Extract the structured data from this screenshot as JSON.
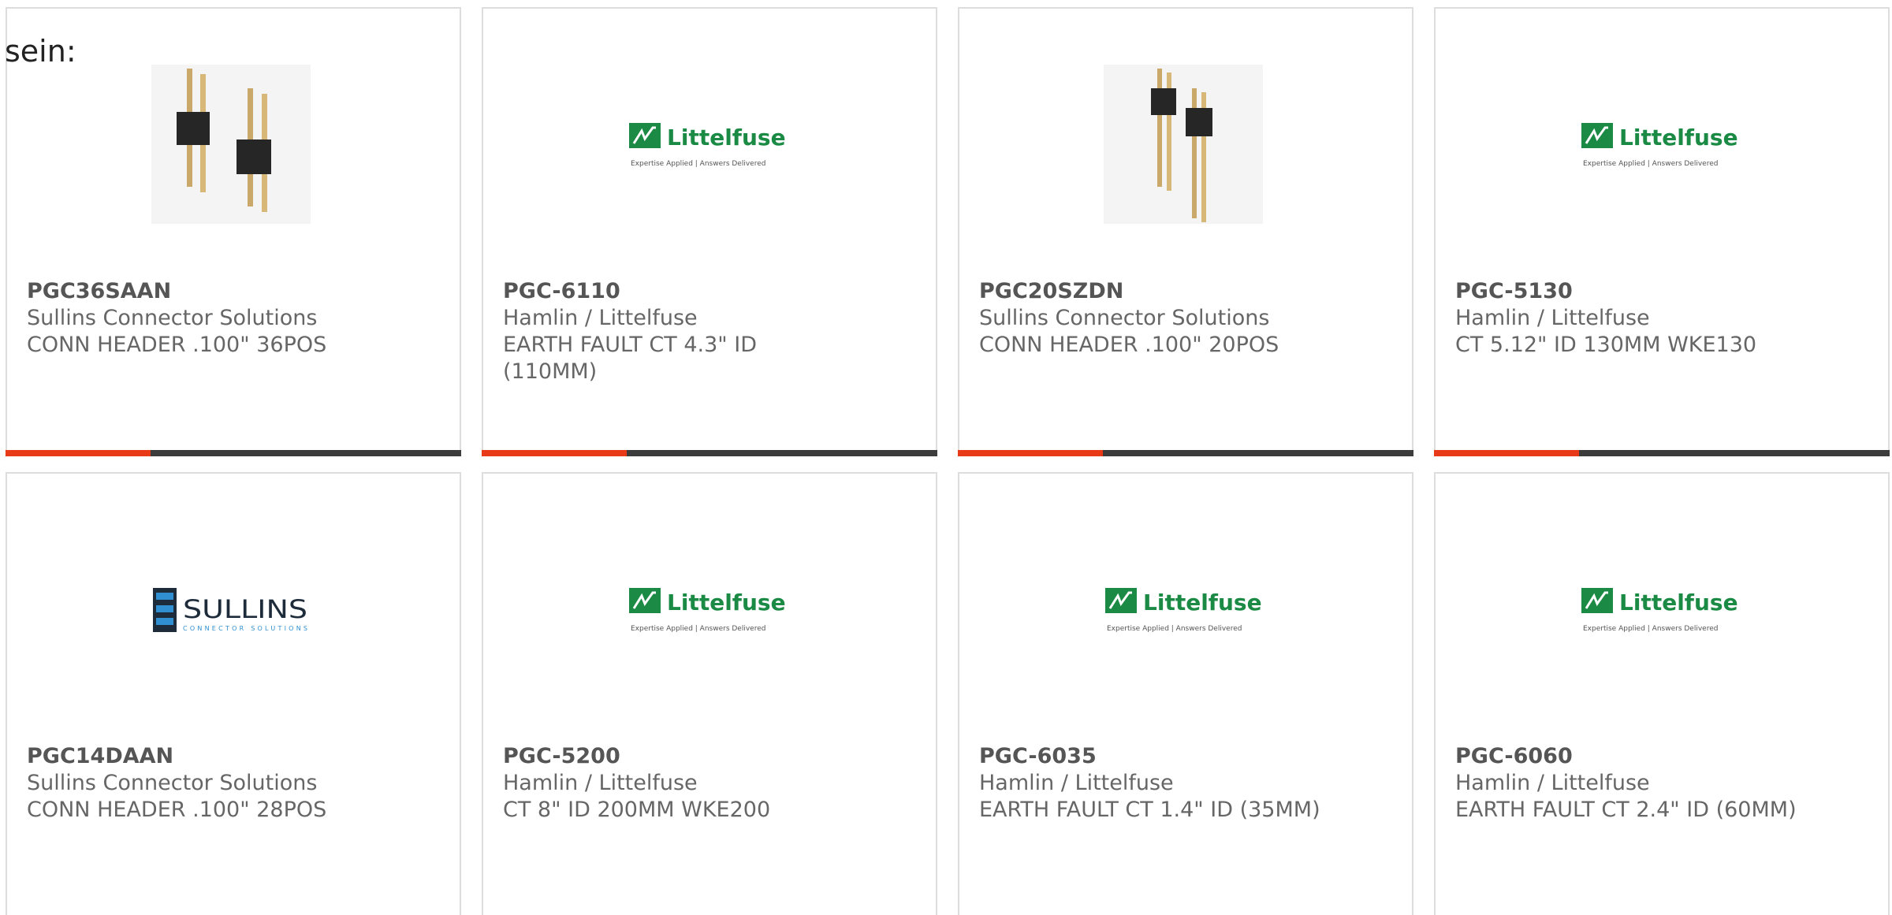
{
  "intro_text": "sein:",
  "colors": {
    "accent": "#e83a16",
    "bar": "#3c3c3c",
    "littelfuse_green": "#1a8a44",
    "sullins_blue": "#1d5fa0"
  },
  "products": [
    {
      "part_number": "PGC36SAAN",
      "manufacturer": "Sullins Connector Solutions",
      "description": "CONN HEADER .100\" 36POS",
      "image": "pin-header-photo"
    },
    {
      "part_number": "PGC-6110",
      "manufacturer": "Hamlin / Littelfuse",
      "description": "EARTH FAULT CT 4.3\" ID (110MM)",
      "image": "littelfuse-logo"
    },
    {
      "part_number": "PGC20SZDN",
      "manufacturer": "Sullins Connector Solutions",
      "description": "CONN HEADER .100\" 20POS",
      "image": "pin-header-photo"
    },
    {
      "part_number": "PGC-5130",
      "manufacturer": "Hamlin / Littelfuse",
      "description": "CT 5.12\" ID 130MM WKE130",
      "image": "littelfuse-logo"
    },
    {
      "part_number": "PGC14DAAN",
      "manufacturer": "Sullins Connector Solutions",
      "description": "CONN HEADER .100\" 28POS",
      "image": "sullins-logo"
    },
    {
      "part_number": "PGC-5200",
      "manufacturer": "Hamlin / Littelfuse",
      "description": "CT 8\" ID 200MM WKE200",
      "image": "littelfuse-logo"
    },
    {
      "part_number": "PGC-6035",
      "manufacturer": "Hamlin / Littelfuse",
      "description": "EARTH FAULT CT 1.4\" ID (35MM)",
      "image": "littelfuse-logo"
    },
    {
      "part_number": "PGC-6060",
      "manufacturer": "Hamlin / Littelfuse",
      "description": "EARTH FAULT CT 2.4\" ID (60MM)",
      "image": "littelfuse-logo"
    }
  ],
  "logos": {
    "littelfuse": {
      "name": "Littelfuse",
      "tagline": "Expertise Applied | Answers Delivered"
    },
    "sullins": {
      "name": "SULLINS",
      "tagline": "CONNECTOR SOLUTIONS"
    }
  }
}
